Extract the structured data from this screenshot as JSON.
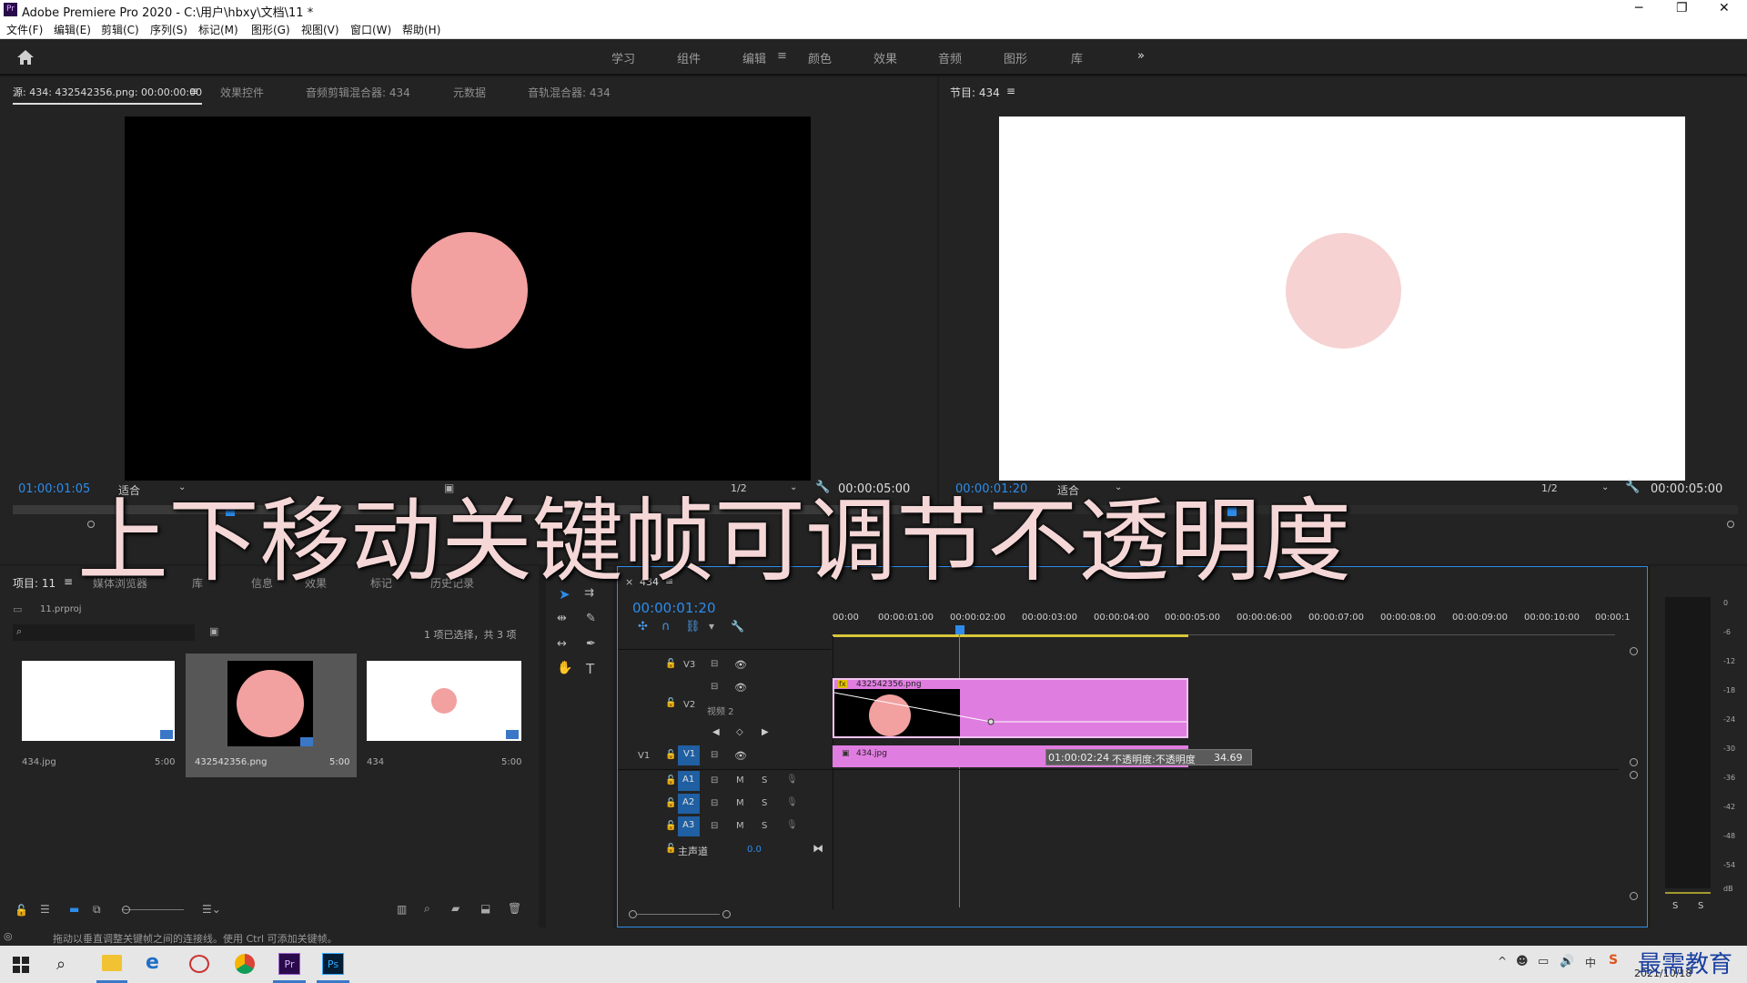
{
  "window": {
    "title": "Adobe Premiere Pro 2020 - C:\\用户\\hbxy\\文档\\11 *",
    "app_badge": "Pr",
    "min": "─",
    "max": "❐",
    "close": "✕"
  },
  "menu": [
    "文件(F)",
    "编辑(E)",
    "剪辑(C)",
    "序列(S)",
    "标记(M)",
    "图形(G)",
    "视图(V)",
    "窗口(W)",
    "帮助(H)"
  ],
  "workspaces": {
    "items": [
      "学习",
      "组件",
      "编辑",
      "颜色",
      "效果",
      "音频",
      "图形",
      "库"
    ],
    "active": "编辑",
    "more": "»",
    "menu_icon": "≡"
  },
  "source_panel": {
    "tabs": [
      "源: 434: 432542356.png: 00:00:00:00",
      "效果控件",
      "音频剪辑混合器: 434",
      "元数据",
      "音轨混合器: 434"
    ],
    "menu_icon": "≡",
    "timecode": "01:00:01:05",
    "fit": "适合",
    "resolution": "1/2",
    "duration": "00:00:05:00"
  },
  "program_panel": {
    "tab": "节目: 434",
    "menu_icon": "≡",
    "timecode": "00:00:01:20",
    "fit": "适合",
    "resolution": "1/2",
    "duration": "00:00:05:00"
  },
  "project_panel": {
    "tabs": [
      "项目: 11",
      "媒体浏览器",
      "库",
      "信息",
      "效果",
      "标记",
      "历史记录"
    ],
    "menu_icon": "≡",
    "file": "11.prproj",
    "selection": "1 项已选择，共 3 项",
    "items": [
      {
        "name": "434.jpg",
        "duration": "5:00"
      },
      {
        "name": "432542356.png",
        "duration": "5:00"
      },
      {
        "name": "434",
        "duration": "5:00"
      }
    ]
  },
  "timeline": {
    "tab": "434",
    "close": "×",
    "menu_icon": "≡",
    "timecode": "00:00:01:20",
    "ruler": [
      "00:00",
      "00:00:01:00",
      "00:00:02:00",
      "00:00:03:00",
      "00:00:04:00",
      "00:00:05:00",
      "00:00:06:00",
      "00:00:07:00",
      "00:00:08:00",
      "00:00:09:00",
      "00:00:10:00",
      "00:00:1"
    ],
    "tracks": {
      "v3": "V3",
      "v2": "V2",
      "v1": "V1",
      "v1_src": "V1",
      "v2_name": "视频 2",
      "a1": "A1",
      "a2": "A2",
      "a3": "A3",
      "master": "主声道",
      "master_val": "0.0",
      "m": "M",
      "s": "S"
    },
    "clip_v2": "432542356.png",
    "clip_v1": "434.jpg",
    "clip_v2_fx": "fx",
    "tooltip_time": "01:00:02:24",
    "tooltip_label": "不透明度:不透明度",
    "tooltip_value": "34.69"
  },
  "meter": {
    "scale": [
      "0",
      "-6",
      "-12",
      "-18",
      "-24",
      "-30",
      "-36",
      "-42",
      "-48",
      "-54",
      "dB"
    ],
    "solo1": "S",
    "solo2": "S"
  },
  "status": "拖动以垂直调整关键帧之间的连接线。使用 Ctrl 可添加关键帧。",
  "overlay_caption": "上下移动关键帧可调节不透明度",
  "taskbar": {
    "date": "2021/10/18",
    "ime": "中",
    "watermark": "最需教育",
    "pr": "Pr",
    "ps": "Ps"
  },
  "colors": {
    "accent": "#2d8ceb",
    "clip_pink": "#e07de0",
    "circle": "#f2a0a0",
    "panel": "#232323"
  }
}
